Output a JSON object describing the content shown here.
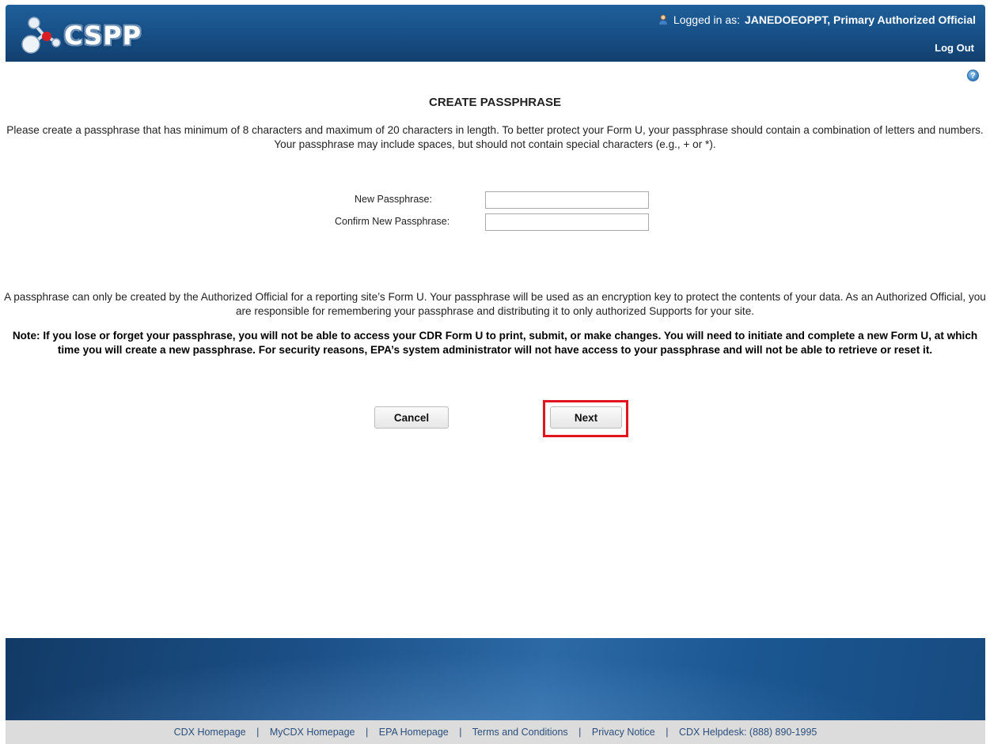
{
  "header": {
    "logo_text": "CSPP",
    "logged_in_prefix": "Logged in as:",
    "user": "JANEDOEOPPT, Primary Authorized Official",
    "logout": "Log Out"
  },
  "help_icon": "?",
  "page": {
    "title": "CREATE PASSPHRASE",
    "intro": "Please create a passphrase that has minimum of 8 characters and maximum of 20 characters in length. To better protect your Form U, your passphrase should contain a combination of letters and numbers. Your passphrase may include spaces, but should not contain special characters (e.g., + or *).",
    "new_label": "New Passphrase:",
    "new_value": "",
    "confirm_label": "Confirm New Passphrase:",
    "confirm_value": "",
    "para2": "A passphrase can only be created by the Authorized Official for a reporting site’s Form U. Your passphrase will be used as an encryption key to protect the contents of your data. As an Authorized Official, you are responsible for remembering your passphrase and distributing it to only authorized Supports for your site.",
    "note": "Note: If you lose or forget your passphrase, you will not be able to access your CDR Form U to print, submit, or make changes. You will need to initiate and complete a new Form U, at which time you will create a new passphrase. For security reasons, EPA’s system administrator will not have access to your passphrase and will not be able to retrieve or reset it.",
    "cancel": "Cancel",
    "next": "Next"
  },
  "footer": {
    "links": [
      "CDX Homepage",
      "MyCDX Homepage",
      "EPA Homepage",
      "Terms and Conditions",
      "Privacy Notice",
      "CDX Helpdesk: (888) 890-1995"
    ],
    "separator": "|"
  },
  "colors": {
    "header_blue": "#174f86",
    "highlight_red": "#e2131e",
    "footer_link": "#2a4f7c"
  },
  "icons": [
    "cspp-logo-icon",
    "user-icon",
    "help-icon"
  ]
}
